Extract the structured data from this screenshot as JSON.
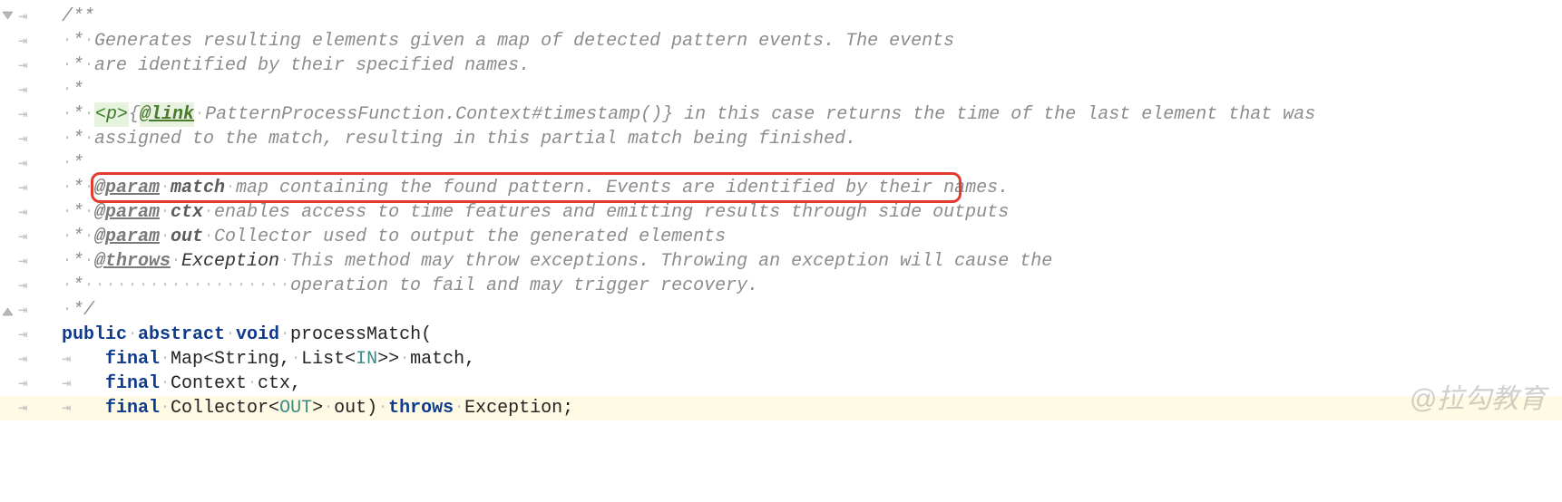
{
  "javadoc": {
    "open": "/**",
    "line1": "Generates resulting elements given a map of detected pattern events. The events",
    "line2": "are identified by their specified names.",
    "p_tag": "<p>",
    "link_tag": "@link",
    "link_target": "PatternProcessFunction.Context#timestamp()",
    "link_after": " in this case returns the time of the last element that was",
    "line5": "assigned to the match, resulting in this partial match being finished.",
    "param1_tag": "@param",
    "param1_name": "match",
    "param1_desc": "map containing the found pattern. Events are identified by their names.",
    "param2_tag": "@param",
    "param2_name": "ctx",
    "param2_desc": "enables access to time features and emitting results through side outputs",
    "param3_tag": "@param",
    "param3_name": "out",
    "param3_desc": "Collector used to output the generated elements",
    "throws_tag": "@throws",
    "throws_name": "Exception",
    "throws_desc1": "This method may throw exceptions. Throwing an exception will cause the",
    "throws_desc2": "operation to fail and may trigger recovery.",
    "close": "*/"
  },
  "code": {
    "kw_public": "public",
    "kw_abstract": "abstract",
    "kw_void": "void",
    "method_name": "processMatch",
    "kw_final1": "final",
    "type_map": "Map",
    "type_string": "String",
    "type_list": "List",
    "type_in": "IN",
    "param_match": "match",
    "kw_final2": "final",
    "type_context": "Context",
    "param_ctx": "ctx",
    "kw_final3": "final",
    "type_collector": "Collector",
    "type_out": "OUT",
    "param_out": "out",
    "kw_throws": "throws",
    "type_exception": "Exception"
  },
  "watermark": "@拉勾教育"
}
